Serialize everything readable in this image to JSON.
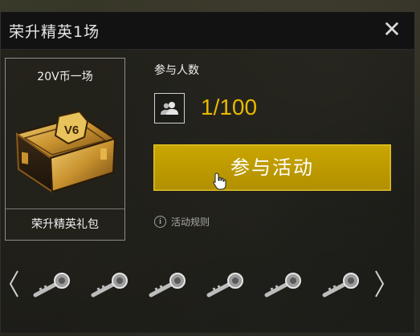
{
  "dialog": {
    "title": "荣升精英1场",
    "close_symbol": "✕"
  },
  "reward": {
    "top_label": "20V币一场",
    "bottom_label": "荣升精英礼包",
    "chest_emblem": "V6"
  },
  "participants": {
    "label": "参与人数",
    "count": "1/100",
    "count_color": "#e8b800"
  },
  "join_button": {
    "label": "参与活动",
    "color": "#c9a600"
  },
  "rules_link": {
    "label": "活动规则"
  },
  "key_row": {
    "item_icon": "key-icon",
    "item_count": 6
  }
}
